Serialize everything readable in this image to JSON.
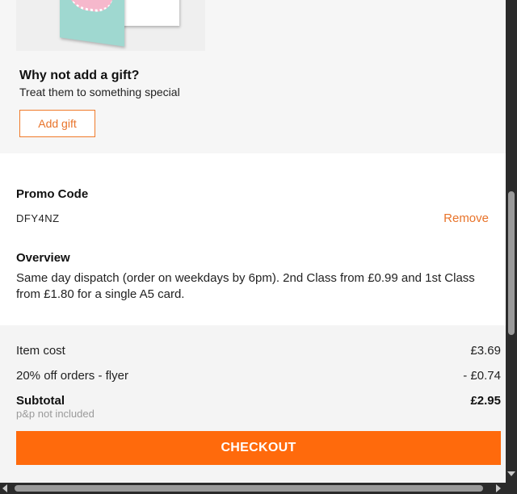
{
  "gift": {
    "title": "Why not add a gift?",
    "subtitle": "Treat them to something special",
    "button_label": "Add gift"
  },
  "promo": {
    "title": "Promo Code",
    "code": "DFY4NZ",
    "remove_label": "Remove"
  },
  "overview": {
    "title": "Overview",
    "text": "Same day dispatch (order on weekdays by 6pm). 2nd Class from £0.99 and 1st Class from £1.80 for a single A5 card."
  },
  "totals": {
    "item_cost_label": "Item cost",
    "item_cost_value": "£3.69",
    "discount_label": "20% off orders - flyer",
    "discount_value": "- £0.74",
    "subtotal_label": "Subtotal",
    "subtotal_value": "£2.95",
    "pp_note": "p&p not included"
  },
  "checkout": {
    "label": "CHECKOUT"
  },
  "colors": {
    "accent": "#ff6a0c",
    "link": "#e8732a",
    "gift_bg": "#f6f6f6",
    "totals_bg": "#f4f4f4"
  }
}
